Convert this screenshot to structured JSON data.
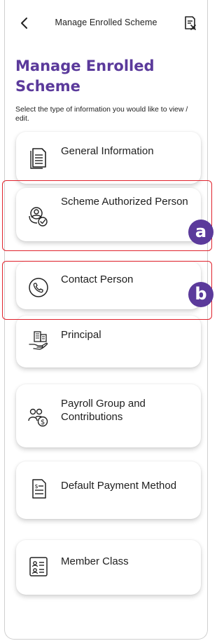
{
  "header": {
    "title": "Manage Enrolled Scheme",
    "back_icon": "chevron-left-icon",
    "action_icon": "document-x-icon"
  },
  "page": {
    "title": "Manage Enrolled Scheme",
    "instruction": "Select the type of information you would like to view / edit."
  },
  "menu": {
    "items": [
      {
        "label": "General Information",
        "icon": "document-icon"
      },
      {
        "label": "Scheme Authorized Person",
        "icon": "user-check-icon"
      },
      {
        "label": "Contact Person",
        "icon": "phone-icon"
      },
      {
        "label": "Principal",
        "icon": "building-hand-icon"
      },
      {
        "label": "Payroll Group and Contributions",
        "icon": "group-dollar-icon"
      },
      {
        "label": "Default Payment Method",
        "icon": "dollar-document-icon"
      },
      {
        "label": "Member Class",
        "icon": "id-list-icon"
      }
    ]
  },
  "annotations": {
    "a": "a",
    "b": "b"
  },
  "colors": {
    "brand_purple": "#5b3a9b",
    "highlight_red": "#e0232d"
  }
}
